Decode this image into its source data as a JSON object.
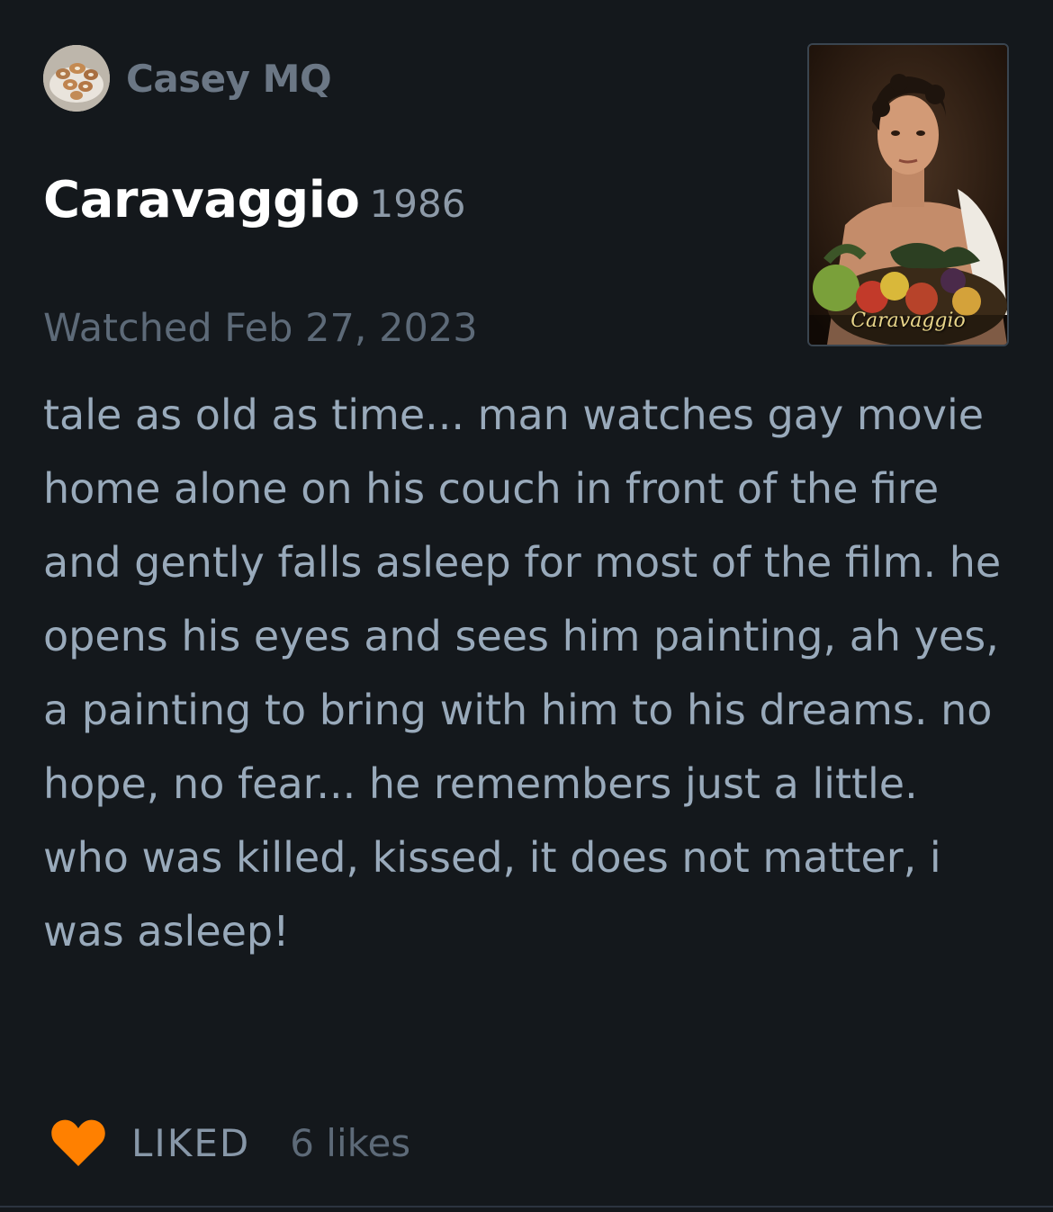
{
  "review": {
    "author": "Casey MQ",
    "film_title": "Caravaggio",
    "film_year": "1986",
    "watched_label": "Watched Feb 27, 2023",
    "poster_text": "Caravaggio",
    "body": "tale as old as time... man watches gay movie home alone on his couch in front of the fire and gently falls asleep for most of the film. he opens his eyes and sees him painting, ah yes, a painting to bring with him to his dreams. no hope,  no fear... he remembers just a little. who was killed, kissed, it does not matter, i was asleep!"
  },
  "footer": {
    "liked_label": "LIKED",
    "likes_count": "6 likes"
  },
  "colors": {
    "background": "#14181c",
    "heart": "#ff8000",
    "body_text": "#99aabb"
  },
  "icons": {
    "heart": "heart-icon",
    "avatar": "avatar"
  }
}
